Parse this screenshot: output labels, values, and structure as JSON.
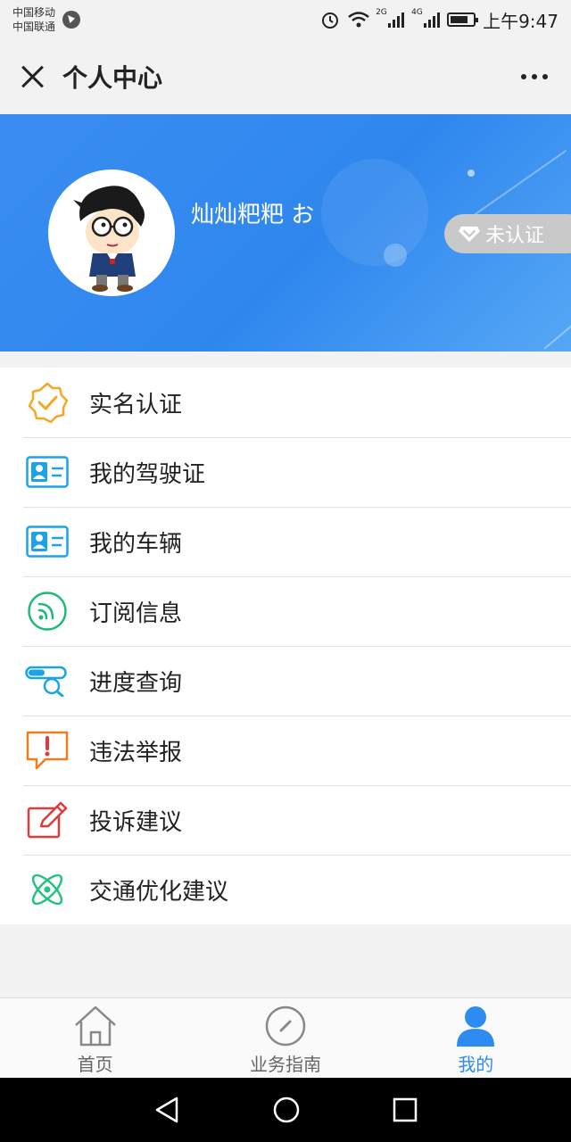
{
  "status_bar": {
    "carrier_1": "中国移动",
    "carrier_2": "中国联通",
    "network_1": "2G",
    "network_2": "4G",
    "time": "上午9:47"
  },
  "title_bar": {
    "title": "个人中心"
  },
  "profile": {
    "username": "灿灿粑粑 お",
    "verify_status": "未认证"
  },
  "menu": {
    "items": [
      {
        "label": "实名认证",
        "icon": "verified-badge-icon"
      },
      {
        "label": "我的驾驶证",
        "icon": "id-card-icon"
      },
      {
        "label": "我的车辆",
        "icon": "id-card-icon"
      },
      {
        "label": "订阅信息",
        "icon": "rss-icon"
      },
      {
        "label": "进度查询",
        "icon": "progress-search-icon"
      },
      {
        "label": "违法举报",
        "icon": "report-alert-icon"
      },
      {
        "label": "投诉建议",
        "icon": "edit-icon"
      },
      {
        "label": "交通优化建议",
        "icon": "atom-icon"
      }
    ]
  },
  "tab_bar": {
    "tabs": [
      {
        "label": "首页",
        "icon": "home-icon",
        "active": false
      },
      {
        "label": "业务指南",
        "icon": "compass-icon",
        "active": false
      },
      {
        "label": "我的",
        "icon": "user-icon",
        "active": true
      }
    ]
  },
  "colors": {
    "brand_blue": "#2e8cf0",
    "verify_orange": "#f5a623",
    "card_blue": "#1aa3e8",
    "rss_green": "#1fb97a",
    "report_orange": "#f07c1a",
    "edit_red": "#e03a3a",
    "atom_green": "#26c281"
  }
}
